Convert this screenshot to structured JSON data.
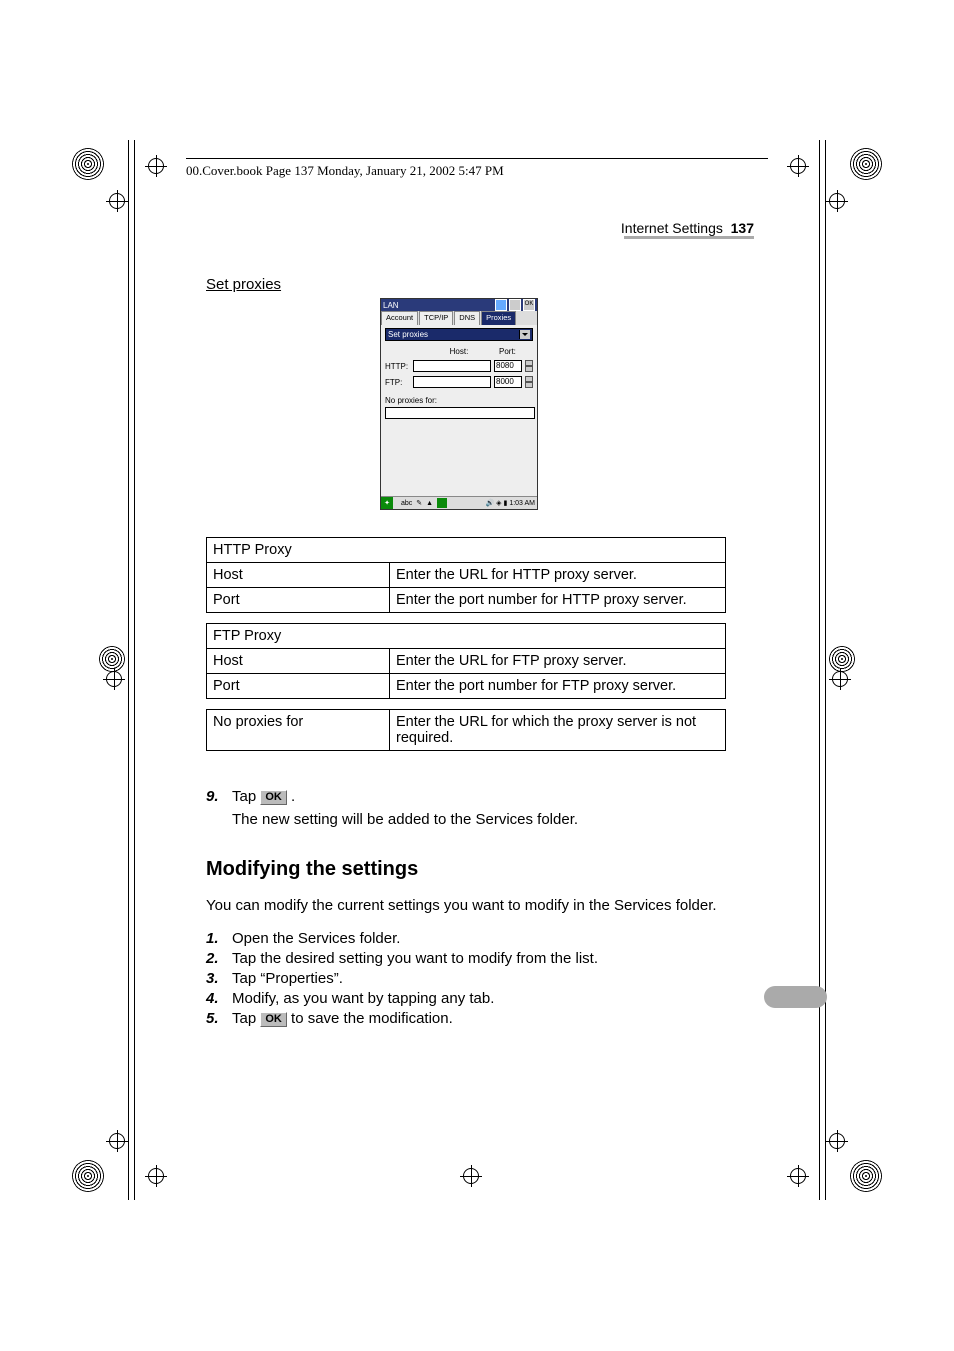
{
  "header_text": "00.Cover.book  Page 137  Monday, January 21, 2002  5:47 PM",
  "running_head": {
    "title": "Internet Settings",
    "page": "137"
  },
  "section_title": "Set proxies",
  "pda": {
    "title": "LAN",
    "tabs": [
      "Account",
      "TCP/IP",
      "DNS",
      "Proxies"
    ],
    "select_label": "Set proxies",
    "host_label": "Host:",
    "port_label": "Port:",
    "http_label": "HTTP:",
    "ftp_label": "FTP:",
    "http_port": "8080",
    "ftp_port": "8000",
    "no_proxies_label": "No proxies for:",
    "time": "1:03 AM"
  },
  "tables": {
    "http": {
      "header": "HTTP Proxy",
      "host_label": "Host",
      "host_desc": "Enter the URL for HTTP proxy server.",
      "port_label": "Port",
      "port_desc": "Enter the port number for HTTP proxy server."
    },
    "ftp": {
      "header": "FTP Proxy",
      "host_label": "Host",
      "host_desc": "Enter the URL for FTP proxy server.",
      "port_label": "Port",
      "port_desc": "Enter the port number for FTP proxy server."
    },
    "noproxies": {
      "label": "No proxies for",
      "desc": "Enter the URL for which the proxy server is not required."
    }
  },
  "step9": {
    "num": "9.",
    "pre": "Tap ",
    "ok": "OK",
    "post": ".",
    "sub": "The new setting will be added to the Services folder."
  },
  "h2": "Modifying the settings",
  "para": "You can modify the current settings you want to modify in the Services folder.",
  "steps": [
    {
      "num": "1.",
      "text": "Open the Services folder."
    },
    {
      "num": "2.",
      "text": "Tap the desired setting you want to modify from the list."
    },
    {
      "num": "3.",
      "text": "Tap “Properties”."
    },
    {
      "num": "4.",
      "text": "Modify, as you want by tapping any tab."
    }
  ],
  "step5": {
    "num": "5.",
    "pre": "Tap ",
    "ok": "OK",
    "post": " to save the modification."
  }
}
